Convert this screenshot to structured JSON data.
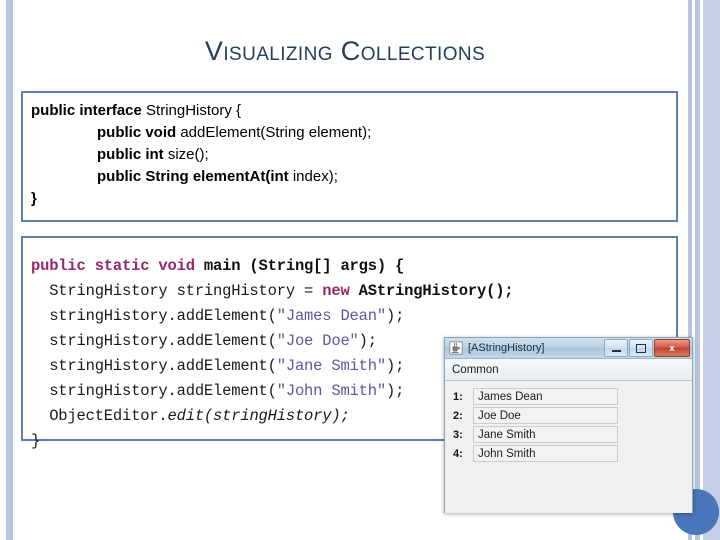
{
  "slide": {
    "title": "Visualizing Collections",
    "accent_border_color": "#5b81ad",
    "title_color": "#243e5c",
    "decor_color": "#b7c5e3",
    "circle_color": "#4a77bb"
  },
  "code_interface": {
    "lines": [
      {
        "indent": false,
        "bold": "public interface",
        "plain": " StringHistory {"
      },
      {
        "indent": true,
        "bold": "public void",
        "plain": " addElement(String element);"
      },
      {
        "indent": true,
        "bold": "public int",
        "plain": " size();"
      },
      {
        "indent": true,
        "bold": "public String elementAt(",
        "plain": "",
        "bold2": "int",
        "plain2": " index);"
      },
      {
        "indent": false,
        "bold": "}",
        "plain": ""
      }
    ],
    "l0_bold": "public interface",
    "l0_plain": " StringHistory {",
    "l1_bold": "public void",
    "l1_plain": " addElement(String element);",
    "l2_bold": "public int",
    "l2_plain": " size();",
    "l3_bold_a": "public String elementAt(",
    "l3_bold_b": "int",
    "l3_plain": " index);",
    "l4": "}"
  },
  "code_main": {
    "l0_kw1": "public static void",
    "l0_rest": " main (String[] args) {",
    "l1_a": "  StringHistory stringHistory = ",
    "l1_kw": "new",
    "l1_b": " ",
    "l1_c": "AStringHistory();",
    "l2_a": "  stringHistory.addElement(",
    "l2_str": "\"James Dean\"",
    "l2_b": ");",
    "l3_a": "  stringHistory.addElement(",
    "l3_str": "\"Joe Doe\"",
    "l3_b": ");",
    "l4_a": "  stringHistory.addElement(",
    "l4_str": "\"Jane Smith\"",
    "l4_b": ");",
    "l5_a": "  stringHistory.addElement(",
    "l5_str": "\"John Smith\"",
    "l5_b": ");",
    "l6_a": "  ObjectEditor.",
    "l6_ital": "edit(stringHistory);",
    "l7": "}",
    "keyword_color": "#96286b",
    "string_color": "#5a5a9c"
  },
  "java_window": {
    "title": "[AStringHistory]",
    "icon": "java-cup-icon",
    "minimize_label": "minimize",
    "maximize_label": "maximize",
    "close_label": "x",
    "menu": [
      "Common"
    ],
    "menu_common": "Common",
    "rows": [
      {
        "index": "1:",
        "value": "James Dean"
      },
      {
        "index": "2:",
        "value": "Joe Doe"
      },
      {
        "index": "3:",
        "value": "Jane Smith"
      },
      {
        "index": "4:",
        "value": "John Smith"
      }
    ]
  }
}
